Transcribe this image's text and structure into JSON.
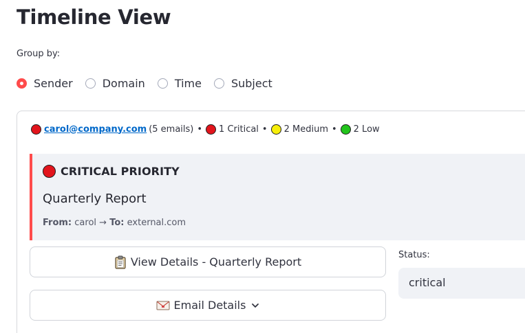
{
  "page": {
    "title": "Timeline View"
  },
  "group_by": {
    "label": "Group by:",
    "options": [
      "Sender",
      "Domain",
      "Time",
      "Subject"
    ],
    "selected": "Sender"
  },
  "summary": {
    "sender": "carol@company.com",
    "email_count": "(5 emails)",
    "separator": "•",
    "critical": "1 Critical",
    "medium": "2 Medium",
    "low": "2 Low"
  },
  "priority_card": {
    "heading": "CRITICAL PRIORITY",
    "subject": "Quarterly Report",
    "from_label": "From:",
    "from_value": "carol",
    "arrow": "→",
    "to_label": "To:",
    "to_value": "external.com",
    "accent_color": "#ff4b4b"
  },
  "buttons": {
    "view_details": "View Details - Quarterly Report",
    "view_details_icon": "clipboard-icon",
    "email_details": "Email Details",
    "email_details_icon": "envelope-icon"
  },
  "status": {
    "label": "Status:",
    "value": "critical"
  },
  "colors": {
    "critical": "#e2141c",
    "medium": "#f7ef0a",
    "low": "#22c41c",
    "link": "#0068c9"
  }
}
